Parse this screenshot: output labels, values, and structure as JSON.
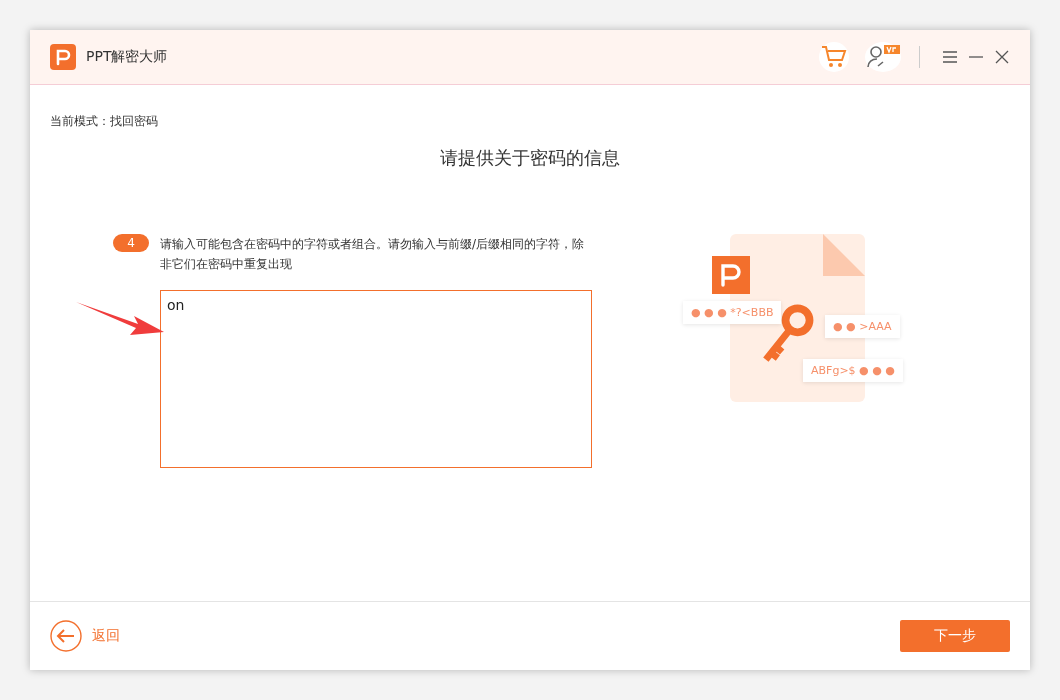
{
  "window": {
    "title": "PPT解密大师"
  },
  "mode_label": "当前模式：找回密码",
  "heading": "请提供关于密码的信息",
  "step": {
    "number": "4",
    "instruction": "请输入可能包含在密码中的字符或者组合。请勿输入与前缀/后缀相同的字符，除非它们在密码中重复出现"
  },
  "answer": {
    "value": "on"
  },
  "illustration": {
    "tags": [
      {
        "text": "● ● ● *?<BBB"
      },
      {
        "text": "● ● >AAA"
      },
      {
        "text": "ABFg>$ ● ● ●"
      }
    ]
  },
  "footer": {
    "back": "返回",
    "next": "下一步"
  }
}
